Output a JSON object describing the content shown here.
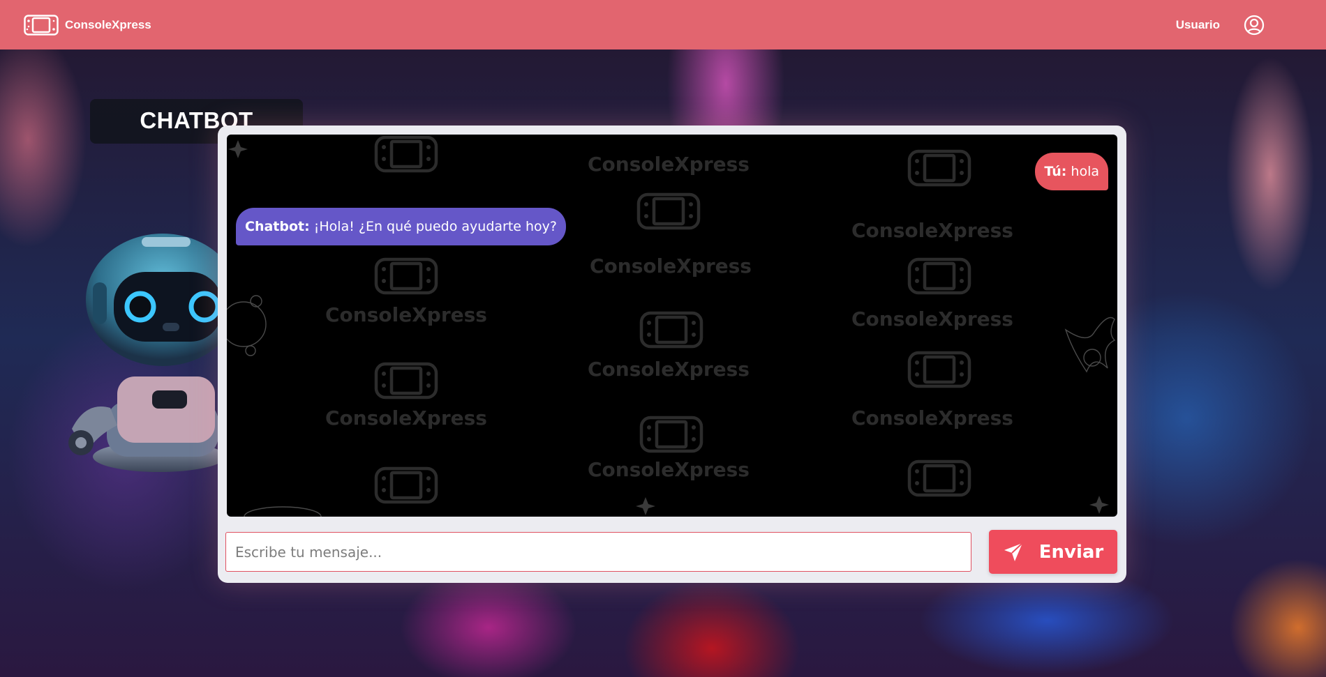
{
  "header": {
    "brand": "ConsoleXpress",
    "user_label": "Usuario",
    "logo_icon": "console-icon",
    "account_icon": "user-circle-icon",
    "color": "#e2656f"
  },
  "chat": {
    "title": "CHATBOT",
    "watermark": "ConsoleXpress",
    "messages": [
      {
        "sender": "Tú:",
        "text": " hola",
        "role": "user",
        "color": "#e7555e"
      },
      {
        "sender": "Chatbot:",
        "text": " ¡Hola! ¿En qué puedo ayudarte hoy?",
        "role": "bot",
        "color": "#6557c8"
      }
    ],
    "input": {
      "placeholder": "Escribe tu mensaje...",
      "value": ""
    },
    "send": {
      "label": "Enviar",
      "icon": "send-icon",
      "color": "#ef4c5c"
    }
  }
}
